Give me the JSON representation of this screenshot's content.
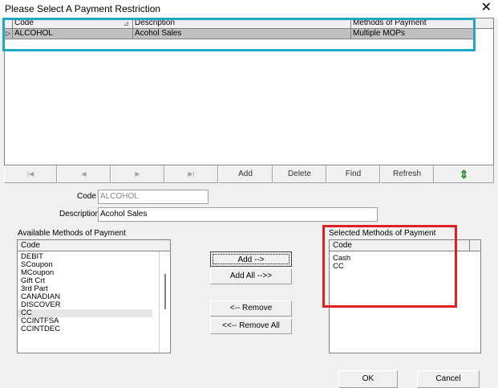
{
  "window": {
    "title": "Please Select A Payment Restriction",
    "close_glyph": "✕"
  },
  "grid": {
    "columns": [
      "Code",
      "Description",
      "Methods of Payment"
    ],
    "sort_indicator": "⊿",
    "row_indicator": "▷",
    "rows": [
      {
        "code": "ALCOHOL",
        "description": "Acohol Sales",
        "mop": "Multiple MOPs"
      }
    ]
  },
  "navigator": {
    "first": "|◀",
    "prev": "◀",
    "next": "▶",
    "last": "▶|",
    "add": "Add",
    "delete": "Delete",
    "find": "Find",
    "refresh": "Refresh",
    "refresh_icon": "⇕"
  },
  "form": {
    "code_label": "Code",
    "code_value": "ALCOHOL",
    "description_label": "Description",
    "description_value": "Acohol Sales"
  },
  "available": {
    "label": "Available Methods of Payment",
    "header": "Code",
    "items": [
      "DEBIT",
      "SCoupon",
      "MCoupon",
      "Gift Crt",
      "3rd Part",
      "CANADIAN",
      "DISCOVER",
      "CC",
      "CCINTFSA",
      "CCINTDEC"
    ]
  },
  "transfer": {
    "add": "Add -->",
    "add_all": "Add All -->>",
    "remove": "<-- Remove",
    "remove_all": "<<-- Remove All"
  },
  "selected": {
    "label": "Selected Methods of Payment",
    "header": "Code",
    "items": [
      "Cash",
      "CC"
    ]
  },
  "footer": {
    "ok": "OK",
    "cancel": "Cancel"
  },
  "colors": {
    "highlight_cyan": "#1fa6c8",
    "highlight_red": "#e02020"
  }
}
